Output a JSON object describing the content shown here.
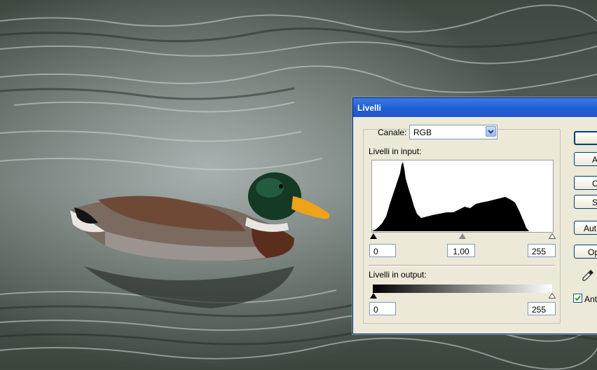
{
  "dialog": {
    "title": "Livelli",
    "channel_label": "Canale:",
    "channel_value": "RGB",
    "input_levels_label": "Livelli in input:",
    "input_black": "0",
    "input_gamma": "1,00",
    "input_white": "255",
    "output_levels_label": "Livelli in output:",
    "output_black": "0",
    "output_white": "255",
    "buttons": {
      "ok": "",
      "cancel": "A",
      "load": "Ca",
      "save": "Sa",
      "auto": "Aut",
      "options": "Op"
    },
    "preview_label": "Ant",
    "preview_checked": true
  },
  "colors": {
    "title_bar": "#1f5fd6",
    "dialog_face": "#ece9d8",
    "field_border": "#7f9db9"
  },
  "icons": [
    "chevron-down-icon",
    "eyedropper-icon",
    "checkmark-icon"
  ]
}
